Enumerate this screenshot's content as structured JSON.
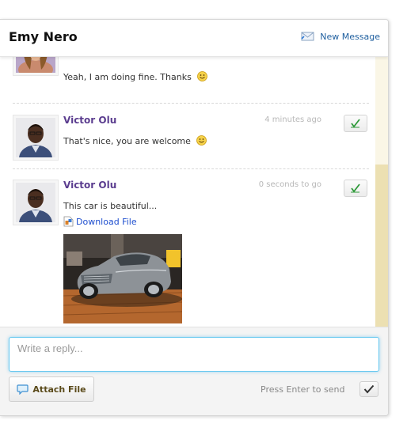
{
  "header": {
    "title": "Emy Nero",
    "new_message_label": "New Message"
  },
  "messages": [
    {
      "sender": "",
      "time": "",
      "text": "Yeah, I am doing fine. Thanks"
    },
    {
      "sender": "Victor Olu",
      "time": "4 minutes ago",
      "text": "That's nice, you are welcome"
    },
    {
      "sender": "Victor Olu",
      "time": "0 seconds to go",
      "text": "This car is beautiful...",
      "attachment_label": "Download File"
    }
  ],
  "composer": {
    "placeholder": "Write a reply...",
    "attach_label": "Attach File",
    "enter_hint": "Press Enter to send"
  },
  "colors": {
    "sender_name": "#5b3d8f",
    "link": "#1f4fcf",
    "input_focus": "#66c8f0",
    "scroll_thumb": "#ece0b2"
  },
  "icons": {
    "new_message": "envelope-icon",
    "smiley": "smiley-icon",
    "action": "check-icon",
    "file": "file-icon",
    "attach": "speech-bubble-icon",
    "send": "checkmark-icon"
  }
}
